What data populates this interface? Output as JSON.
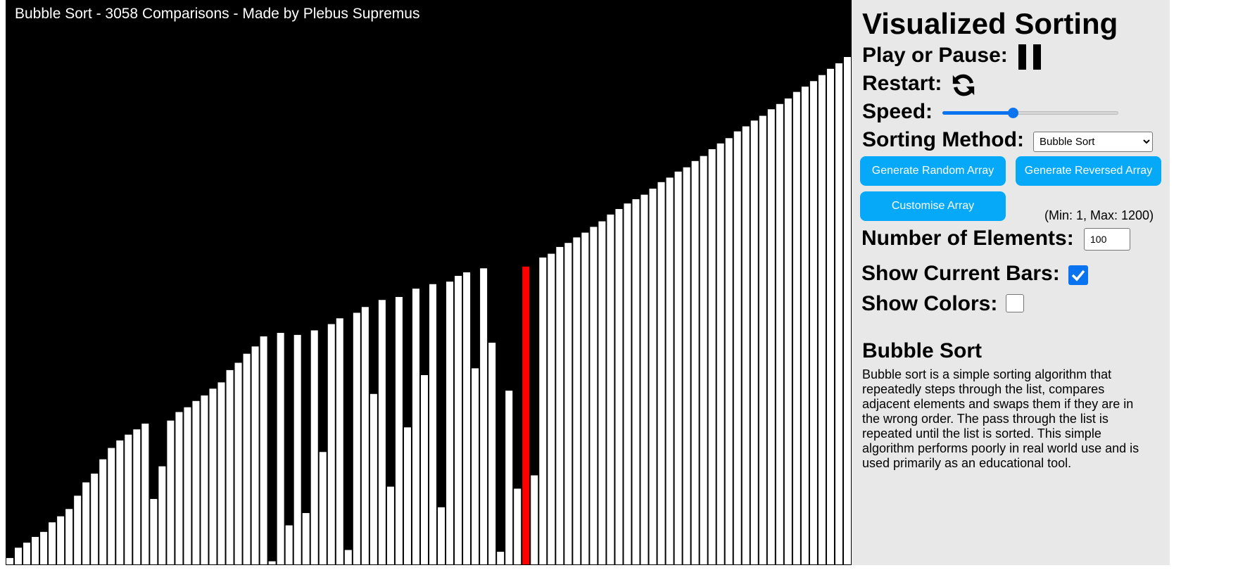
{
  "canvas": {
    "status_title": "Bubble Sort - 3058 Comparisons - Made by Plebus Supremus",
    "background_color": "#000000",
    "bar_color": "#ffffff",
    "highlight_color": "#ff0000",
    "max_value": 1200,
    "highlight_index": 61,
    "values": [
      31,
      72,
      92,
      115,
      135,
      173,
      197,
      226,
      279,
      332,
      367,
      424,
      469,
      499,
      522,
      543,
      566,
      266,
      396,
      578,
      612,
      631,
      656,
      678,
      705,
      730,
      779,
      808,
      844,
      873,
      913,
      18,
      927,
      161,
      919,
      210,
      937,
      453,
      962,
      985,
      63,
      1007,
      1030,
      684,
      1058,
      315,
      1070,
      551,
      1103,
      759,
      1121,
      233,
      1131,
      1154,
      1168,
      786,
      1184,
      888,
      56,
      697,
      307,
      1191,
      360,
      1227,
      1242,
      1269,
      1285,
      1307,
      1326,
      1349,
      1371,
      1398,
      1420,
      1442,
      1459,
      1477,
      1501,
      1527,
      1545,
      1569,
      1586,
      1611,
      1631,
      1658,
      1681,
      1702,
      1729,
      1749,
      1772,
      1791,
      1817,
      1838,
      1860,
      1886,
      1907,
      1929,
      1953,
      1978,
      2000,
      2025
    ]
  },
  "panel": {
    "title": "Visualized Sorting",
    "play_label": "Play or Pause:",
    "play_icon": "pause-icon",
    "restart_label": "Restart:",
    "restart_icon": "refresh-icon",
    "speed_label": "Speed:",
    "speed_value": 0.4,
    "method_label": "Sorting Method:",
    "method_selected": "Bubble Sort",
    "btn_random": "Generate Random Array",
    "btn_reversed": "Generate Reversed Array",
    "btn_custom": "Customise Array",
    "minmax": "(Min: 1, Max: 1200)",
    "num_label": "Number of Elements:",
    "num_value": "100",
    "show_bars_label": "Show Current Bars:",
    "show_bars_checked": true,
    "show_colors_label": "Show Colors:",
    "show_colors_checked": false,
    "algo_title": "Bubble Sort",
    "algo_desc": "Bubble sort is a simple sorting algorithm that repeatedly steps through the list, compares adjacent elements and swaps them if they are in the wrong order. The pass through the list is repeated until the list is sorted. This simple algorithm performs poorly in real world use and is used primarily as an educational tool.",
    "accent_color": "#06a9f8"
  }
}
